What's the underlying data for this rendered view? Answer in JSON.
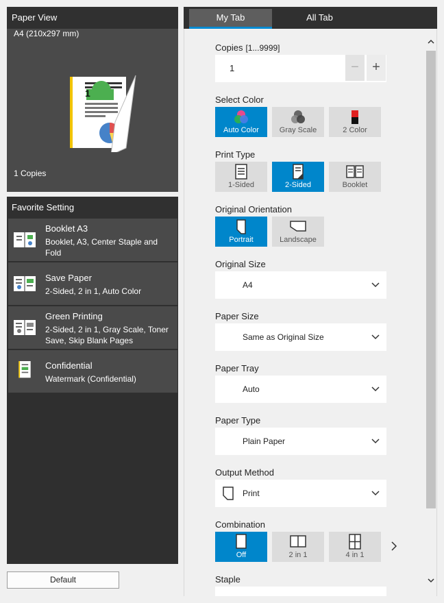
{
  "paper_view": {
    "title": "Paper View",
    "size": "A4 (210x297 mm)",
    "copies": "1 Copies",
    "page_number": "1"
  },
  "favorites": {
    "title": "Favorite Setting",
    "items": [
      {
        "name": "Booklet A3",
        "desc": "Booklet, A3, Center Staple and Fold"
      },
      {
        "name": "Save Paper",
        "desc": "2-Sided, 2 in 1, Auto Color"
      },
      {
        "name": "Green Printing",
        "desc": "2-Sided, 2 in 1, Gray Scale, Toner Save, Skip Blank Pages"
      },
      {
        "name": "Confidential",
        "desc": "Watermark (Confidential)"
      }
    ]
  },
  "default_button": "Default",
  "tabs": [
    {
      "label": "My Tab",
      "active": true
    },
    {
      "label": "All Tab",
      "active": false
    }
  ],
  "copies": {
    "label": "Copies",
    "range": "[1...9999]",
    "value": "1",
    "minus": "−",
    "plus": "+"
  },
  "select_color": {
    "label": "Select Color",
    "options": [
      {
        "label": "Auto Color",
        "icon": "auto-color-icon",
        "selected": true
      },
      {
        "label": "Gray Scale",
        "icon": "gray-scale-icon",
        "selected": false
      },
      {
        "label": "2 Color",
        "icon": "two-color-icon",
        "selected": false
      }
    ]
  },
  "print_type": {
    "label": "Print Type",
    "options": [
      {
        "label": "1-Sided",
        "icon": "one-sided-icon",
        "selected": false
      },
      {
        "label": "2-Sided",
        "icon": "two-sided-icon",
        "selected": true
      },
      {
        "label": "Booklet",
        "icon": "booklet-icon",
        "selected": false
      }
    ]
  },
  "orientation": {
    "label": "Original Orientation",
    "options": [
      {
        "label": "Portrait",
        "icon": "portrait-icon",
        "selected": true
      },
      {
        "label": "Landscape",
        "icon": "landscape-icon",
        "selected": false
      }
    ]
  },
  "original_size": {
    "label": "Original Size",
    "value": "A4"
  },
  "paper_size": {
    "label": "Paper Size",
    "value": "Same as Original Size"
  },
  "paper_tray": {
    "label": "Paper Tray",
    "value": "Auto"
  },
  "paper_type": {
    "label": "Paper Type",
    "value": "Plain Paper"
  },
  "output_method": {
    "label": "Output Method",
    "value": "Print"
  },
  "combination": {
    "label": "Combination",
    "options": [
      {
        "label": "Off",
        "icon": "off-icon",
        "selected": true
      },
      {
        "label": "2 in 1",
        "icon": "two-in-one-icon",
        "selected": false
      },
      {
        "label": "4 in 1",
        "icon": "four-in-one-icon",
        "selected": false
      }
    ]
  },
  "staple": {
    "label": "Staple"
  },
  "colors": {
    "accent": "#0086cb",
    "header": "#303030",
    "panel": "#4a4a4a"
  }
}
